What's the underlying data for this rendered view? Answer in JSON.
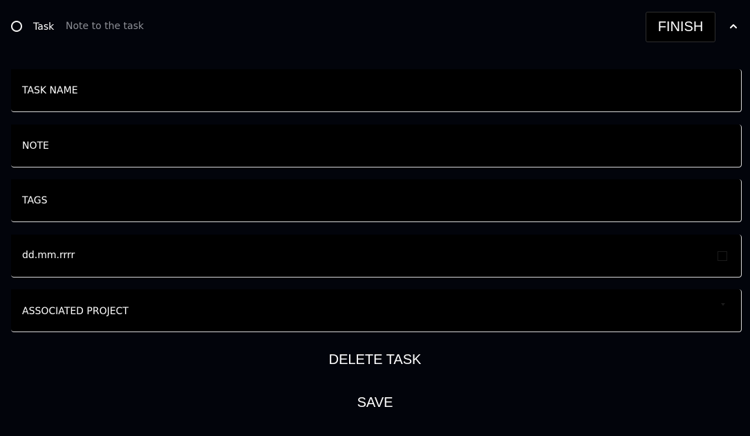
{
  "header": {
    "task_label": "Task",
    "note_placeholder": "Note to the task",
    "finish_label": "FINISH"
  },
  "form": {
    "task_name": "TASK NAME",
    "note": "NOTE",
    "tags": "TAGS",
    "date": "dd.mm.rrrr",
    "project": "ASSOCIATED PROJECT"
  },
  "actions": {
    "delete_label": "DELETE TASK",
    "save_label": "SAVE"
  },
  "icons": {
    "status": "radio-circle-icon",
    "collapse": "chevron-up-icon",
    "calendar": "calendar-icon"
  },
  "colors": {
    "background": "#02040b",
    "text": "#ffffff",
    "muted": "#8d8f96",
    "border": "#d9d9d9"
  }
}
